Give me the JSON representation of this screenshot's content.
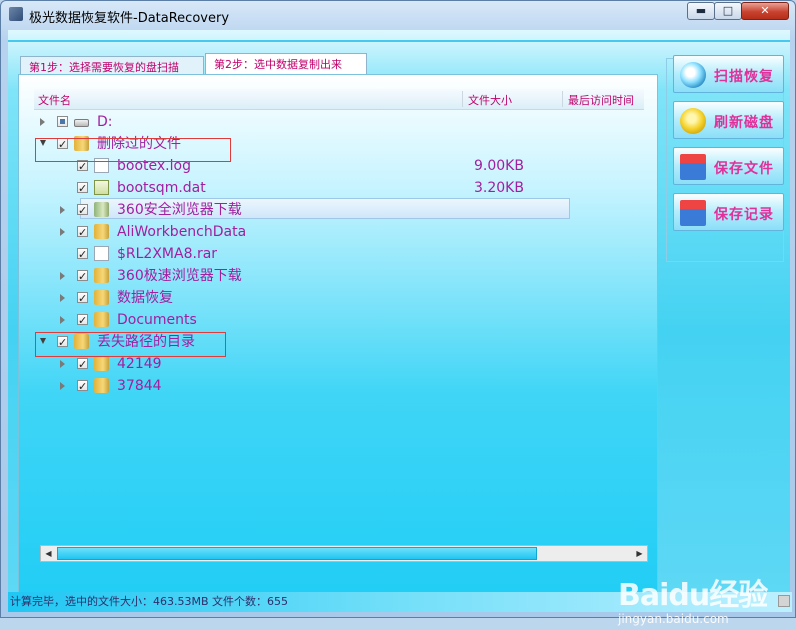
{
  "window": {
    "title": "极光数据恢复软件-DataRecovery",
    "min_glyph": "▬",
    "max_glyph": "□",
    "close_glyph": "✕"
  },
  "tabs": [
    {
      "label": "第1步：选择需要恢复的盘扫描",
      "active": false
    },
    {
      "label": "第2步：选中数据复制出来",
      "active": true
    }
  ],
  "tree": {
    "columns": [
      "文件名",
      "文件大小",
      "最后访问时间"
    ],
    "rows": [
      {
        "name": "D:",
        "size": "",
        "level": 0,
        "icon": "drive-icon",
        "expand": "closed",
        "check": "partial"
      },
      {
        "name": "删除过的文件",
        "size": "",
        "level": 0,
        "icon": "folder-icon",
        "expand": "open",
        "check": "checked"
      },
      {
        "name": "bootex.log",
        "size": "9.00KB",
        "level": 1,
        "icon": "file-icon",
        "expand": "none",
        "check": "checked"
      },
      {
        "name": "bootsqm.dat",
        "size": "3.20KB",
        "level": 1,
        "icon": "dat-file-icon",
        "expand": "none",
        "check": "checked"
      },
      {
        "name": "360安全浏览器下载",
        "size": "",
        "level": 1,
        "icon": "folder-icon",
        "expand": "closed",
        "check": "checked"
      },
      {
        "name": "AliWorkbenchData",
        "size": "",
        "level": 1,
        "icon": "folder-icon",
        "expand": "closed",
        "check": "checked"
      },
      {
        "name": "$RL2XMA8.rar",
        "size": "",
        "level": 1,
        "icon": "file-icon",
        "expand": "none",
        "check": "checked"
      },
      {
        "name": "360极速浏览器下载",
        "size": "",
        "level": 1,
        "icon": "folder-icon",
        "expand": "closed",
        "check": "checked"
      },
      {
        "name": "数据恢复",
        "size": "",
        "level": 1,
        "icon": "folder-icon",
        "expand": "closed",
        "check": "checked"
      },
      {
        "name": "Documents",
        "size": "",
        "level": 1,
        "icon": "folder-icon",
        "expand": "closed",
        "check": "checked"
      },
      {
        "name": "丢失路径的目录",
        "size": "",
        "level": 0,
        "icon": "folder-icon",
        "expand": "open",
        "check": "checked"
      },
      {
        "name": "42149",
        "size": "",
        "level": 1,
        "icon": "folder-icon",
        "expand": "closed",
        "check": "checked"
      },
      {
        "name": "37844",
        "size": "",
        "level": 1,
        "icon": "folder-icon",
        "expand": "closed",
        "check": "checked"
      }
    ]
  },
  "buttons": {
    "scan": "扫描恢复",
    "refresh": "刷新磁盘",
    "save_files": "保存文件",
    "save_log": "保存记录"
  },
  "status": {
    "text": "计算完毕，选中的文件大小：463.53MB 文件个数：655"
  },
  "watermark": {
    "brand": "Baidu经验",
    "url": "jingyan.baidu.com"
  },
  "colors": {
    "accent_pink": "#c0006b",
    "tree_text": "#a020a0",
    "client_cyan": "#44d2f2",
    "annotation_red": "#e03b3b"
  }
}
